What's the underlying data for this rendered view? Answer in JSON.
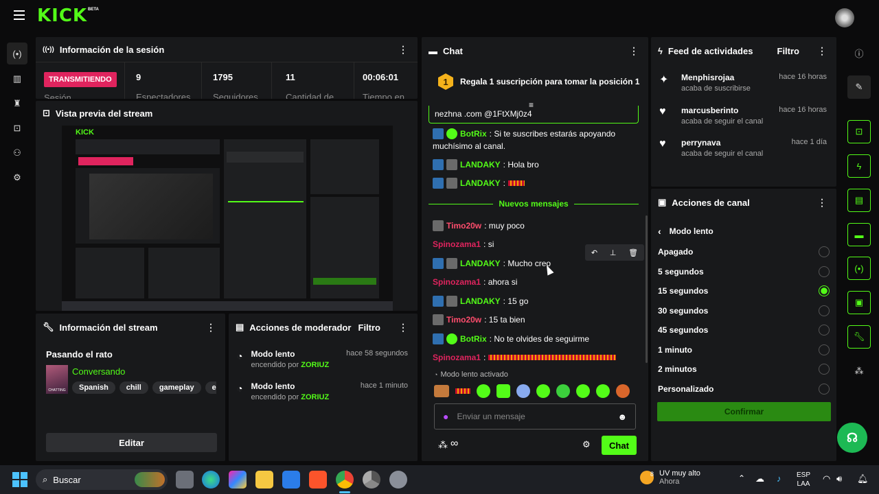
{
  "brand": {
    "logo": "KICK",
    "beta": "BETA",
    "accent": "#53fc18"
  },
  "session": {
    "title": "Información de la sesión",
    "live_label": "TRANSMITIENDO",
    "stats": [
      {
        "value": "9",
        "label": "Espectadores"
      },
      {
        "value": "1795",
        "label": "Seguidores"
      },
      {
        "value": "11",
        "label": "Cantidad de"
      },
      {
        "value": "00:06:01",
        "label": "Tiempo en"
      }
    ],
    "partial_label": "Sesión"
  },
  "preview": {
    "title": "Vista previa del stream"
  },
  "stream_info": {
    "title": "Información del stream",
    "stream_title": "Pasando el rato",
    "category": "Conversando",
    "tags": [
      "Spanish",
      "chill",
      "gameplay",
      "espa"
    ],
    "edit_label": "Editar",
    "thumb_text": "CHATTING"
  },
  "mod_actions": {
    "title": "Acciones de moderador",
    "filter": "Filtro",
    "items": [
      {
        "name": "Modo lento",
        "desc_prefix": "encendido por",
        "user": "ZORIUZ",
        "time": "hace 58 segundos"
      },
      {
        "name": "Modo lento",
        "desc_prefix": "encendido por",
        "user": "ZORIUZ",
        "time": "hace 1 minuto"
      }
    ]
  },
  "chat": {
    "title": "Chat",
    "pinned_rank": "1",
    "pinned_text": "Regala 1 suscripción para tomar la posición 1",
    "top_cut": "nezhna .com @1FtXMj0z4",
    "messages": [
      {
        "user": "BotRix",
        "text": ": Si te suscribes estarás apoyando",
        "text2": "muchísimo al canal.",
        "user_color": "#53fc18"
      },
      {
        "user": "LANDAKY",
        "text": ": Hola bro",
        "user_color": "#53fc18"
      },
      {
        "user": "LANDAKY",
        "text": ":",
        "user_color": "#53fc18"
      }
    ],
    "new_label": "Nuevos mensajes",
    "messages2": [
      {
        "user": "Timo20w",
        "text": ": muy poco",
        "user_color": "#ff4d6d"
      },
      {
        "user": "Spinozama1",
        "text": ": si",
        "user_color": "#e0245e"
      },
      {
        "user": "LANDAKY",
        "text": ": Mucho creo",
        "user_color": "#53fc18"
      },
      {
        "user": "Spinozama1",
        "text": ": ahora si",
        "user_color": "#e0245e"
      },
      {
        "user": "LANDAKY",
        "text": ": 15 go",
        "user_color": "#53fc18"
      },
      {
        "user": "Timo20w",
        "text": ": 15 ta bien",
        "user_color": "#ff4d6d"
      },
      {
        "user": "BotRix",
        "text": ": No te olvides de seguirme",
        "user_color": "#53fc18"
      },
      {
        "user": "Spinozama1",
        "text": ":",
        "user_color": "#e0245e"
      }
    ],
    "slow_notice": "Modo lento activado",
    "input_placeholder": "Enviar un mensaje",
    "send_label": "Chat",
    "infinity": "∞"
  },
  "feed": {
    "title": "Feed de actividades",
    "filter": "Filtro",
    "items": [
      {
        "user": "Menphisrojaa",
        "desc": "acaba de suscribirse",
        "time": "hace 16 horas",
        "icon": "star-icon"
      },
      {
        "user": "marcusberinto",
        "desc": "acaba de seguir el canal",
        "time": "hace 16 horas",
        "icon": "heart-icon"
      },
      {
        "user": "perrynava",
        "desc": "acaba de seguir el canal",
        "time": "hace 1 día",
        "icon": "heart-icon"
      }
    ]
  },
  "channel_actions": {
    "title": "Acciones de canal",
    "back_label": "Modo lento",
    "options": [
      {
        "label": "Apagado",
        "selected": false
      },
      {
        "label": "5 segundos",
        "selected": false
      },
      {
        "label": "15 segundos",
        "selected": true
      },
      {
        "label": "30 segundos",
        "selected": false
      },
      {
        "label": "45 segundos",
        "selected": false
      },
      {
        "label": "1 minuto",
        "selected": false
      },
      {
        "label": "2 minutos",
        "selected": false
      },
      {
        "label": "Personalizado",
        "selected": false
      }
    ],
    "confirm_label": "Confirmar"
  },
  "taskbar": {
    "search_placeholder": "Buscar",
    "weather": "UV muy alto",
    "weather_sub": "Ahora",
    "weather_badge": "8",
    "lang": "ESP",
    "region": "LAA"
  }
}
